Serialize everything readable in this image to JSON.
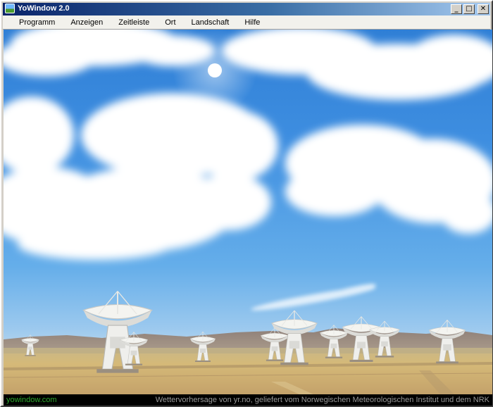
{
  "window": {
    "title": "YoWindow 2.0"
  },
  "title_buttons": {
    "minimize": "_",
    "maximize": "□",
    "close": "✕"
  },
  "menu": [
    {
      "label": "Programm"
    },
    {
      "label": "Anzeigen"
    },
    {
      "label": "Zeitleiste"
    },
    {
      "label": "Ort"
    },
    {
      "label": "Landschaft"
    },
    {
      "label": "Hilfe"
    }
  ],
  "status": {
    "site": "yowindow.com",
    "credit": "Wettervorhersage von yr.no, geliefert vom Norwegischen Meteorologischen Institut und dem NRK"
  },
  "scene": {
    "icons": [
      "sun-icon",
      "cloud-icon",
      "radio-telescope-icon"
    ]
  }
}
